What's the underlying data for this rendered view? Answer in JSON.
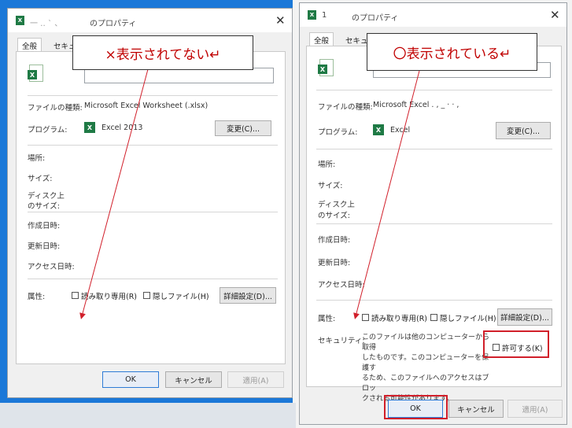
{
  "left": {
    "title_prefix": "一  ‥  `  、",
    "title": "のプロパティ",
    "close": "✕",
    "tabs": [
      "全般",
      "セキュ"
    ],
    "type_label": "ファイルの種類:",
    "type_value": "Microsoft Excel Worksheet (.xlsx)",
    "program_label": "プログラム:",
    "program_value": "Excel 2013",
    "change_button": "変更(C)...",
    "location_label": "場所:",
    "size_label": "サイズ:",
    "disk_size_label_1": "ディスク上",
    "disk_size_label_2": "のサイズ:",
    "created_label": "作成日時:",
    "modified_label": "更新日時:",
    "accessed_label": "アクセス日時:",
    "attributes_label": "属性:",
    "readonly_label": "読み取り専用(R)",
    "hidden_label": "隠しファイル(H)",
    "advanced_button": "詳細設定(D)...",
    "ok_button": "OK",
    "cancel_button": "キャンセル",
    "apply_button": "適用(A)"
  },
  "right": {
    "title_prefix": "1",
    "title": "のプロパティ",
    "close": "✕",
    "tabs": [
      "全般",
      "セキュ"
    ],
    "type_label": "ファイルの種類:",
    "type_value": "Microsoft Excel  .  ,   _   ·   ·  ,",
    "program_label": "プログラム:",
    "program_value": "Excel",
    "change_button": "変更(C)...",
    "location_label": "場所:",
    "size_label": "サイズ:",
    "disk_size_label_1": "ディスク上",
    "disk_size_label_2": "のサイズ:",
    "created_label": "作成日時:",
    "modified_label": "更新日時:",
    "accessed_label": "アクセス日時:",
    "attributes_label": "属性:",
    "readonly_label": "読み取り専用(R)",
    "hidden_label": "隠しファイル(H)",
    "advanced_button": "詳細設定(D)...",
    "security_label": "セキュリティ:",
    "security_text": [
      "このファイルは他のコンピューターから取得",
      "したものです。このコンピューターを保護す",
      "るため、このファイルへのアクセスはブロッ",
      "クされる可能性があります。"
    ],
    "allow_label": "許可する(K)",
    "ok_button": "OK",
    "cancel_button": "キャンセル",
    "apply_button": "適用(A)"
  },
  "annotations": {
    "left_callout": "×表示されてない↵",
    "right_callout": "〇表示されている↵"
  },
  "colors": {
    "desktop_blue": "#1b78d8",
    "annotation_red": "#d11f2a",
    "excel_green": "#1f7a45"
  }
}
